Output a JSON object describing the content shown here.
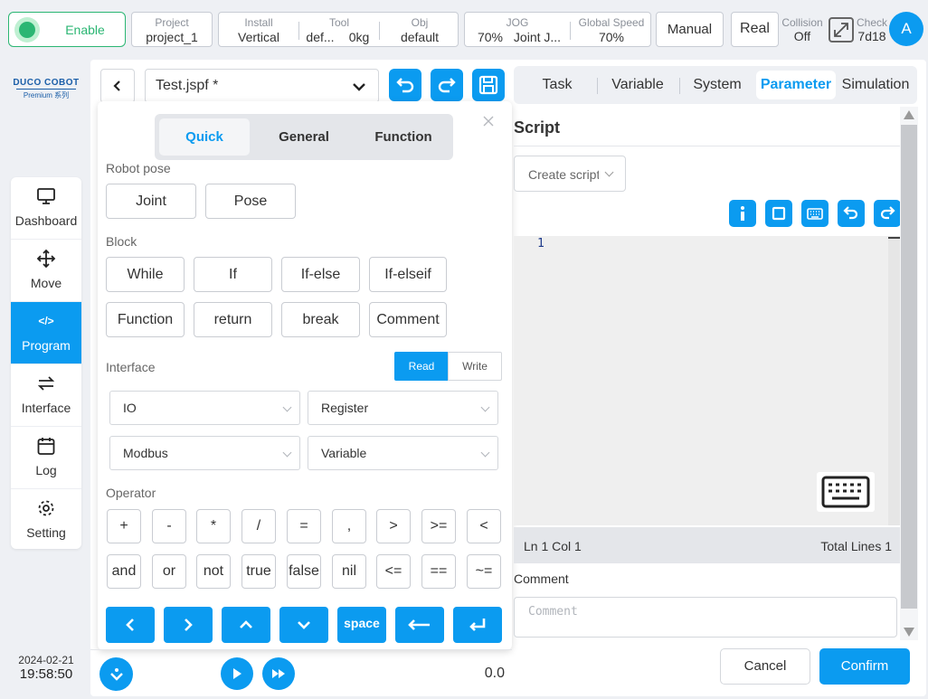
{
  "topbar": {
    "enable_label": "Enable",
    "project": {
      "label": "Project",
      "value": "project_1"
    },
    "install": {
      "label": "Install",
      "value": "Vertical"
    },
    "tool": {
      "label": "Tool",
      "name": "def...",
      "mass": "0kg"
    },
    "obj": {
      "label": "Obj",
      "value": "default"
    },
    "jog": {
      "label": "JOG",
      "value": "70%",
      "mode": "Joint J..."
    },
    "global_speed": {
      "label": "Global Speed",
      "value": "70%"
    },
    "manual_label": "Manual",
    "real_label": "Real",
    "collision": {
      "label": "Collision",
      "value": "Off"
    },
    "check": {
      "label": "Check",
      "value": "7d18"
    },
    "avatar": "A"
  },
  "brand": {
    "name": "DUCO COBOT",
    "sub": "Premium 系列"
  },
  "sidebar": {
    "items": [
      {
        "label": "Dashboard",
        "icon": "monitor-icon"
      },
      {
        "label": "Move",
        "icon": "move-icon"
      },
      {
        "label": "Program",
        "icon": "code-icon",
        "active": true
      },
      {
        "label": "Interface",
        "icon": "swap-icon"
      },
      {
        "label": "Log",
        "icon": "calendar-icon"
      },
      {
        "label": "Setting",
        "icon": "gear-icon"
      }
    ]
  },
  "datetime": {
    "date": "2024-02-21",
    "time": "19:58:50"
  },
  "editor": {
    "file_name": "Test.jspf *"
  },
  "tabs": [
    "Task",
    "Variable",
    "System",
    "Parameter",
    "Simulation"
  ],
  "active_tab": "Parameter",
  "quick_panel": {
    "tabs": [
      "Quick",
      "General",
      "Function"
    ],
    "active_tab": "Quick",
    "robot_pose": {
      "label": "Robot pose",
      "buttons": [
        "Joint",
        "Pose"
      ]
    },
    "block": {
      "label": "Block",
      "row1": [
        "While",
        "If",
        "If-else",
        "If-elseif"
      ],
      "row2": [
        "Function",
        "return",
        "break",
        "Comment"
      ]
    },
    "interface": {
      "label": "Interface",
      "read": "Read",
      "write": "Write",
      "selects": [
        "IO",
        "Register",
        "Modbus",
        "Variable"
      ]
    },
    "operator": {
      "label": "Operator",
      "row1": [
        "+",
        "-",
        "*",
        "/",
        "=",
        ",",
        ">",
        ">=",
        "<"
      ],
      "row2": [
        "and",
        "or",
        "not",
        "true",
        "false",
        "nil",
        "<=",
        "==",
        "~="
      ]
    },
    "keys": {
      "space": "space"
    }
  },
  "script": {
    "title": "Script",
    "create_placeholder": "Create script",
    "line_number": "1",
    "status_pos": "Ln 1 Col 1",
    "total_lines": "Total Lines 1",
    "comment_label": "Comment",
    "comment_placeholder": "Comment"
  },
  "bottom": {
    "speed_value": "0.0",
    "cancel": "Cancel",
    "confirm": "Confirm"
  },
  "colors": {
    "accent": "#0b9bf0",
    "enable_green": "#2bb673"
  }
}
